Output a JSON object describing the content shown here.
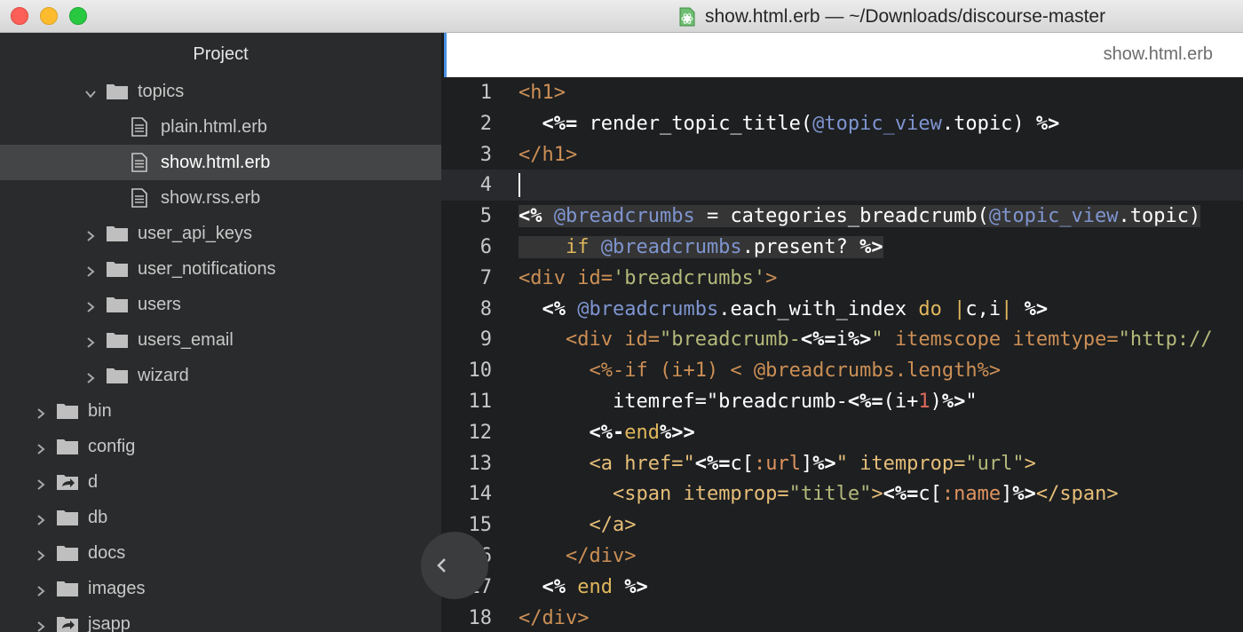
{
  "window": {
    "title": "show.html.erb — ~/Downloads/discourse-master",
    "icon": "atom-file-icon"
  },
  "sidebar": {
    "header": "Project",
    "rows": [
      {
        "label": "topics",
        "kind": "folder",
        "state": "expanded",
        "indent": 1
      },
      {
        "label": "plain.html.erb",
        "kind": "file",
        "indent": 2
      },
      {
        "label": "show.html.erb",
        "kind": "file",
        "indent": 2,
        "selected": true
      },
      {
        "label": "show.rss.erb",
        "kind": "file",
        "indent": 2
      },
      {
        "label": "user_api_keys",
        "kind": "folder",
        "state": "collapsed",
        "indent": 1
      },
      {
        "label": "user_notifications",
        "kind": "folder",
        "state": "collapsed",
        "indent": 1
      },
      {
        "label": "users",
        "kind": "folder",
        "state": "collapsed",
        "indent": 1
      },
      {
        "label": "users_email",
        "kind": "folder",
        "state": "collapsed",
        "indent": 1
      },
      {
        "label": "wizard",
        "kind": "folder",
        "state": "collapsed",
        "indent": 1
      },
      {
        "label": "bin",
        "kind": "folder",
        "state": "collapsed",
        "indent": 0
      },
      {
        "label": "config",
        "kind": "folder",
        "state": "collapsed",
        "indent": 0
      },
      {
        "label": "d",
        "kind": "symlink-folder",
        "state": "collapsed",
        "indent": 0
      },
      {
        "label": "db",
        "kind": "folder",
        "state": "collapsed",
        "indent": 0
      },
      {
        "label": "docs",
        "kind": "folder",
        "state": "collapsed",
        "indent": 0
      },
      {
        "label": "images",
        "kind": "folder",
        "state": "collapsed",
        "indent": 0
      },
      {
        "label": "jsapp",
        "kind": "symlink-folder",
        "state": "collapsed",
        "indent": 0
      }
    ]
  },
  "tab": {
    "label": "show.html.erb"
  },
  "editor": {
    "current_line": 4,
    "lines": [
      {
        "n": "1",
        "tokens": [
          [
            "tag",
            "<h1>"
          ]
        ]
      },
      {
        "n": "2",
        "tokens": [
          [
            "plain",
            "  "
          ],
          [
            "erb",
            "<%="
          ],
          [
            "plain",
            " render_topic_title("
          ],
          [
            "ivar",
            "@topic_view"
          ],
          [
            "plain",
            ".topic) "
          ],
          [
            "erb",
            "%>"
          ]
        ]
      },
      {
        "n": "3",
        "tokens": [
          [
            "tag",
            "</h1>"
          ]
        ]
      },
      {
        "n": "4",
        "tokens": []
      },
      {
        "n": "5",
        "tokens": [
          [
            "erb",
            "<%"
          ],
          [
            "plain",
            " "
          ],
          [
            "ivar",
            "@breadcrumbs"
          ],
          [
            "plain",
            " = categories_breadcrumb("
          ],
          [
            "ivar",
            "@topic_view"
          ],
          [
            "plain",
            ".topic)"
          ]
        ],
        "selected": true
      },
      {
        "n": "6",
        "tokens": [
          [
            "plain",
            "    "
          ],
          [
            "kw",
            "if"
          ],
          [
            "plain",
            " "
          ],
          [
            "ivar",
            "@breadcrumbs"
          ],
          [
            "plain",
            ".present? "
          ],
          [
            "erb",
            "%>"
          ]
        ],
        "selected": true
      },
      {
        "n": "7",
        "tokens": [
          [
            "tag",
            "<div"
          ],
          [
            "plain",
            " "
          ],
          [
            "tag",
            "id="
          ],
          [
            "str",
            "'breadcrumbs'"
          ],
          [
            "tag",
            ">"
          ]
        ]
      },
      {
        "n": "8",
        "tokens": [
          [
            "plain",
            "  "
          ],
          [
            "erb",
            "<%"
          ],
          [
            "plain",
            " "
          ],
          [
            "ivar",
            "@breadcrumbs"
          ],
          [
            "plain",
            ".each_with_index "
          ],
          [
            "kw",
            "do"
          ],
          [
            "plain",
            " "
          ],
          [
            "kw",
            "|"
          ],
          [
            "plain",
            "c,i"
          ],
          [
            "kw",
            "|"
          ],
          [
            "plain",
            " "
          ],
          [
            "erb",
            "%>"
          ]
        ]
      },
      {
        "n": "9",
        "tokens": [
          [
            "plain",
            "    "
          ],
          [
            "tag",
            "<div"
          ],
          [
            "plain",
            " "
          ],
          [
            "tag",
            "id="
          ],
          [
            "str",
            "\"breadcrumb-"
          ],
          [
            "erb",
            "<%="
          ],
          [
            "plain",
            "i"
          ],
          [
            "erb",
            "%>"
          ],
          [
            "str",
            "\""
          ],
          [
            "plain",
            " "
          ],
          [
            "tag",
            "itemscope"
          ],
          [
            "plain",
            " "
          ],
          [
            "tag",
            "itemtype="
          ],
          [
            "str",
            "\"http://"
          ]
        ]
      },
      {
        "n": "10",
        "tokens": [
          [
            "plain",
            "      "
          ],
          [
            "tag",
            "<%-if (i+1) < @breadcrumbs.length%>"
          ]
        ]
      },
      {
        "n": "11",
        "tokens": [
          [
            "plain",
            "        itemref=\"breadcrumb-"
          ],
          [
            "erb",
            "<%="
          ],
          [
            "plain",
            "(i+"
          ],
          [
            "num",
            "1"
          ],
          [
            "plain",
            ")"
          ],
          [
            "erb",
            "%>"
          ],
          [
            "plain",
            "\""
          ]
        ]
      },
      {
        "n": "12",
        "tokens": [
          [
            "plain",
            "      "
          ],
          [
            "erb",
            "<%-"
          ],
          [
            "kw",
            "end"
          ],
          [
            "erb",
            "%>>"
          ]
        ]
      },
      {
        "n": "13",
        "tokens": [
          [
            "plain",
            "      "
          ],
          [
            "attr",
            "<a href=\""
          ],
          [
            "erb",
            "<%="
          ],
          [
            "plain",
            "c["
          ],
          [
            "sym",
            ":url"
          ],
          [
            "plain",
            "]"
          ],
          [
            "erb",
            "%>"
          ],
          [
            "attr",
            "\""
          ],
          [
            "plain",
            " "
          ],
          [
            "attr",
            "itemprop="
          ],
          [
            "str",
            "\"url\""
          ],
          [
            "attr",
            ">"
          ]
        ]
      },
      {
        "n": "14",
        "tokens": [
          [
            "plain",
            "        "
          ],
          [
            "attr",
            "<span"
          ],
          [
            "plain",
            " "
          ],
          [
            "attr",
            "itemprop="
          ],
          [
            "str",
            "\"title\""
          ],
          [
            "attr",
            ">"
          ],
          [
            "erb",
            "<%="
          ],
          [
            "plain",
            "c["
          ],
          [
            "sym",
            ":name"
          ],
          [
            "plain",
            "]"
          ],
          [
            "erb",
            "%>"
          ],
          [
            "attr",
            "</span>"
          ]
        ]
      },
      {
        "n": "15",
        "tokens": [
          [
            "plain",
            "      "
          ],
          [
            "attr",
            "</a>"
          ]
        ]
      },
      {
        "n": "16",
        "tokens": [
          [
            "plain",
            "    "
          ],
          [
            "tag",
            "</div>"
          ]
        ]
      },
      {
        "n": "17",
        "tokens": [
          [
            "plain",
            "  "
          ],
          [
            "erb",
            "<%"
          ],
          [
            "plain",
            " "
          ],
          [
            "kw",
            "end"
          ],
          [
            "plain",
            " "
          ],
          [
            "erb",
            "%>"
          ]
        ]
      },
      {
        "n": "18",
        "tokens": [
          [
            "tag",
            "</div>"
          ]
        ]
      }
    ]
  },
  "colors": {
    "tag": "#cc8f55",
    "ivar": "#7f95d0",
    "keyword": "#e0b75c",
    "string": "#b5b97a",
    "number": "#de6a5c",
    "symbol": "#de935f",
    "editor_bg": "#1d1f21",
    "sidebar_bg": "#2a2b2c"
  },
  "icons": {
    "collapse_panel": "chevron-left-icon"
  }
}
